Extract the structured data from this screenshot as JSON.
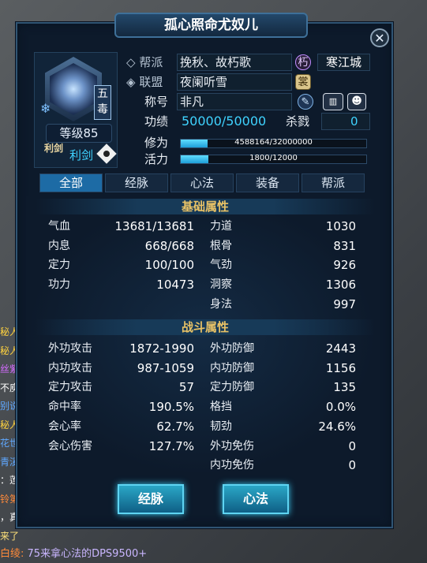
{
  "window": {
    "title": "孤心照命尤奴儿",
    "close_glyph": "✕"
  },
  "character": {
    "school": "五毒",
    "level": "等级85",
    "weapon_icon_text": "利剑",
    "weapon": "利剑"
  },
  "info": {
    "guild_label": "帮派",
    "guild": "挽秋、故朽歌",
    "guild_badge": "朽",
    "city": "寒江城",
    "alliance_label": "联盟",
    "alliance": "夜阑听雪",
    "alliance_badge": "裳",
    "title_label": "称号",
    "title_value": "非凡",
    "merit_label": "功绩",
    "merit": "50000/50000",
    "kills_label": "杀戮",
    "kills": "0",
    "cultivation_label": "修为",
    "cultivation": "4588164/32000000",
    "cultivation_frac": 0.143,
    "vitality_label": "活力",
    "vitality": "1800/12000",
    "vitality_frac": 0.15
  },
  "tabs": [
    "全部",
    "经脉",
    "心法",
    "装备",
    "帮派"
  ],
  "basic": {
    "title": "基础属性",
    "left": [
      {
        "label": "气血",
        "value": "13681/13681"
      },
      {
        "label": "内息",
        "value": "668/668"
      },
      {
        "label": "定力",
        "value": "100/100"
      },
      {
        "label": "功力",
        "value": "10473"
      }
    ],
    "right": [
      {
        "label": "力道",
        "value": "1030"
      },
      {
        "label": "根骨",
        "value": "831"
      },
      {
        "label": "气劲",
        "value": "926"
      },
      {
        "label": "洞察",
        "value": "1306"
      },
      {
        "label": "身法",
        "value": "997"
      }
    ]
  },
  "combat": {
    "title": "战斗属性",
    "left": [
      {
        "label": "外功攻击",
        "value": "1872-1990"
      },
      {
        "label": "内功攻击",
        "value": "987-1059"
      },
      {
        "label": "定力攻击",
        "value": "57"
      },
      {
        "label": "命中率",
        "value": "190.5%"
      },
      {
        "label": "会心率",
        "value": "62.7%"
      },
      {
        "label": "会心伤害",
        "value": "127.7%"
      }
    ],
    "right": [
      {
        "label": "外功防御",
        "value": "2443"
      },
      {
        "label": "内功防御",
        "value": "1156"
      },
      {
        "label": "定力防御",
        "value": "135"
      },
      {
        "label": "格挡",
        "value": "0.0%"
      },
      {
        "label": "韧劲",
        "value": "24.6%"
      },
      {
        "label": "外功免伤",
        "value": "0"
      },
      {
        "label": "内功免伤",
        "value": "0"
      }
    ]
  },
  "buttons": {
    "meridian": "经脉",
    "mentality": "心法"
  },
  "chat": {
    "fragments": [
      {
        "text": "秘人",
        "color": "#ffd23f"
      },
      {
        "text": "秘人",
        "color": "#ffd23f"
      },
      {
        "text": "丝紫",
        "color": "#d46bff"
      },
      {
        "text": "不庾",
        "color": "#ffffff"
      },
      {
        "text": "别说",
        "color": "#5fa8ff"
      },
      {
        "text": "秘人",
        "color": "#ffd23f"
      },
      {
        "text": "花世",
        "color": "#5fa8ff"
      },
      {
        "text": "青溪",
        "color": "#5fa8ff"
      },
      {
        "text": "：莲",
        "color": "#ffffff"
      },
      {
        "text": "铃第",
        "color": "#ff8a3a"
      },
      {
        "text": "，真",
        "color": "#ffffff"
      },
      {
        "text": "来了",
        "color": "#ffe27a"
      }
    ],
    "speaker": "白绫:",
    "message": " 75来拿心法的DPS9500+"
  }
}
